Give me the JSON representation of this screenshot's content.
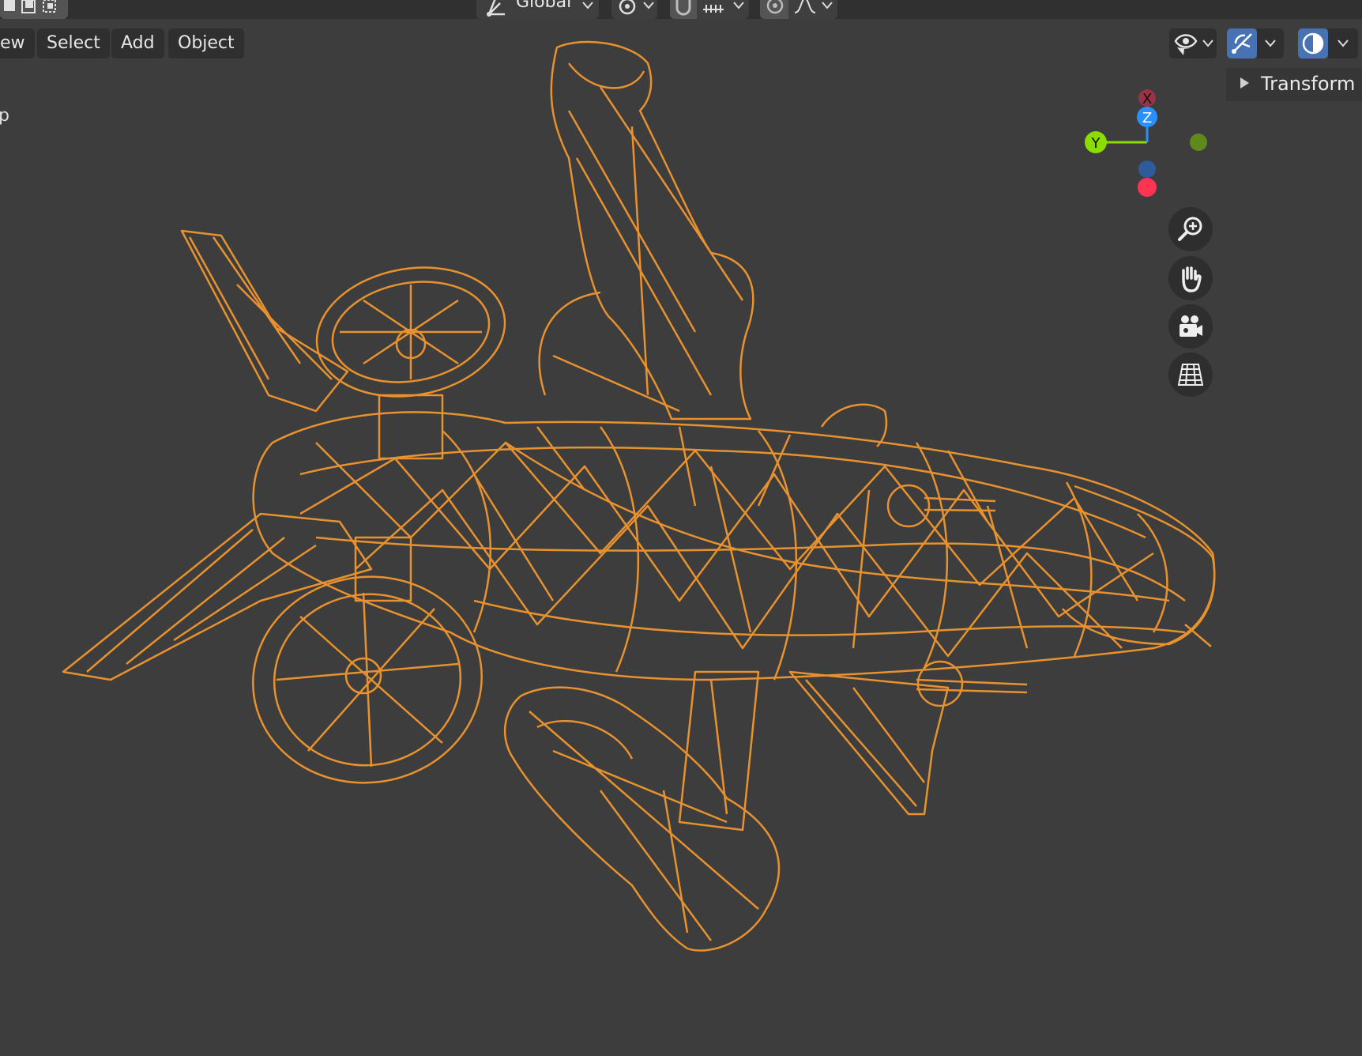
{
  "header": {
    "orientation_label": "Global"
  },
  "menubar": {
    "items": [
      "ew",
      "Select",
      "Add",
      "Object"
    ]
  },
  "left_stub_text": "p",
  "sidebar": {
    "transform_label": "Transform"
  },
  "gizmo": {
    "x_label": "X",
    "y_label": "Y",
    "z_label": "Z"
  },
  "icons": {
    "select_modes": [
      "select-box-icon",
      "select-extend-icon",
      "select-subtract-icon"
    ],
    "transform_orientation": "orientation-icon",
    "pivot": "pivot-icon",
    "snap": "snap-icon",
    "proportional": "proportional-edit-icon",
    "visibility": "eye-icon",
    "gizmo_toggle": "gizmo-icon",
    "overlay_toggle": "overlay-icon",
    "nav": [
      "zoom-icon",
      "hand-icon",
      "camera-icon",
      "grid-icon"
    ]
  },
  "colors": {
    "viewport_bg": "#3d3d3d",
    "wire": "#e8922f",
    "x_axis": "#ff3352",
    "y_axis": "#8bdc00",
    "z_axis": "#2890ff",
    "active_button": "#4772b3"
  }
}
